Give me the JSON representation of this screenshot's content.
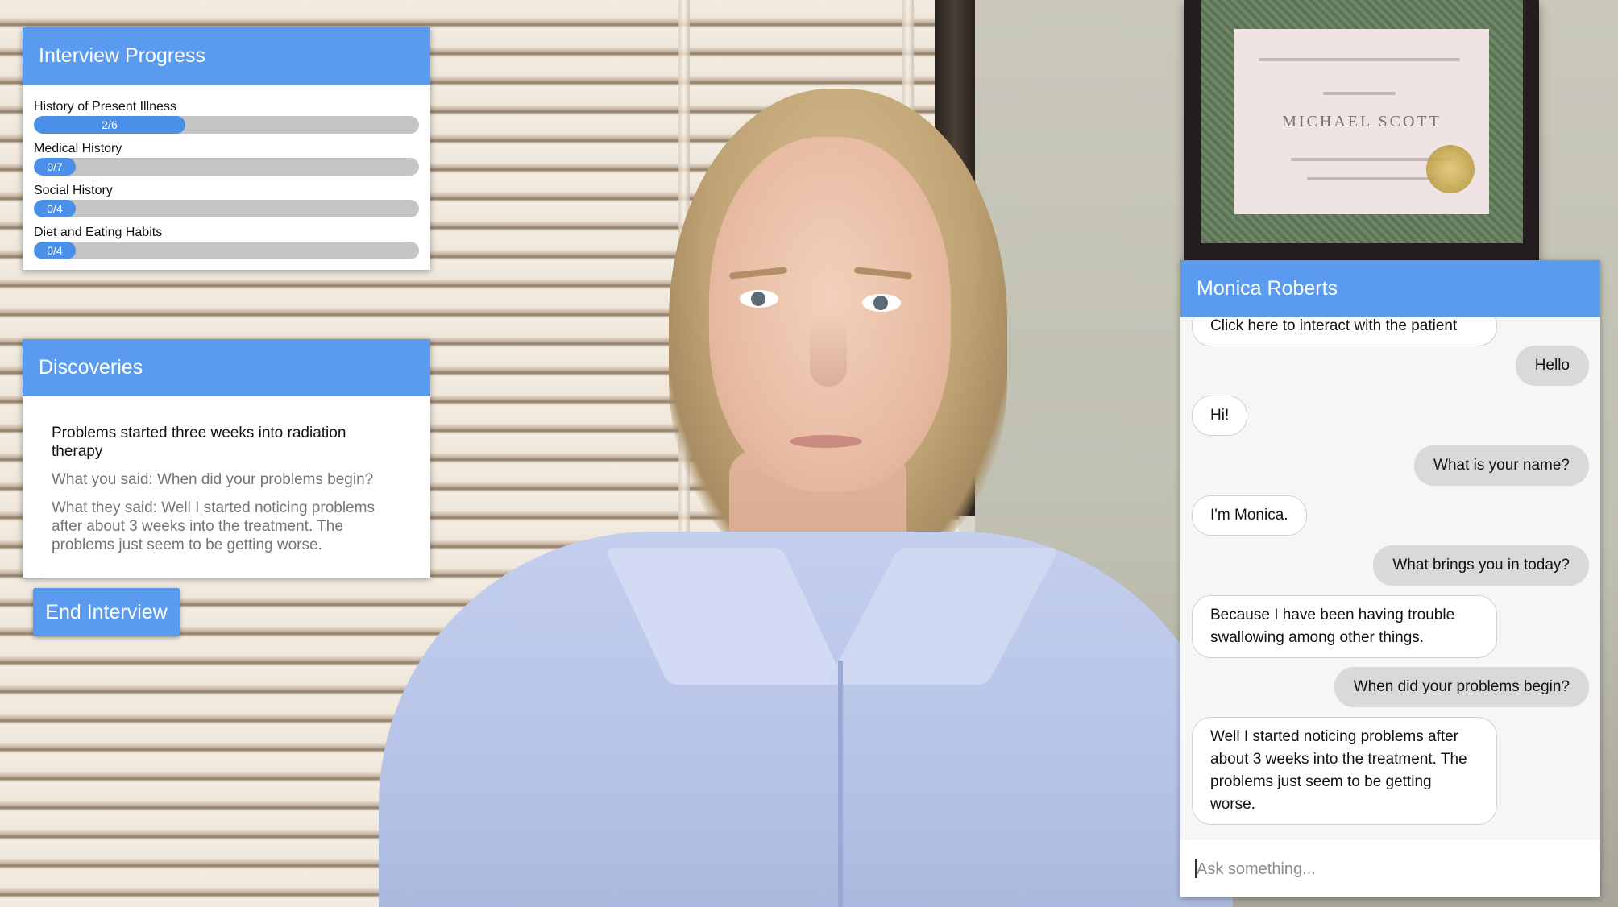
{
  "progress": {
    "title": "Interview Progress",
    "items": [
      {
        "label": "History of Present Illness",
        "display": "2/6",
        "fraction": 0.333
      },
      {
        "label": "Medical History",
        "display": "0/7",
        "fraction": 0
      },
      {
        "label": "Social History",
        "display": "0/4",
        "fraction": 0
      },
      {
        "label": "Diet and Eating Habits",
        "display": "0/4",
        "fraction": 0
      }
    ]
  },
  "discoveries": {
    "title": "Discoveries",
    "items": [
      {
        "heading": "Problems started three weeks into radiation therapy",
        "you_said": "What you said: When did your problems begin?",
        "they_said": "What they said: Well I started noticing problems after about 3 weeks into the treatment. The problems just seem to be getting worse."
      }
    ]
  },
  "actions": {
    "end_interview": "End Interview"
  },
  "chat": {
    "patient_name": "Monica Roberts",
    "messages": [
      {
        "from": "bot",
        "text": "Click here to interact with the patient"
      },
      {
        "from": "user",
        "text": "Hello"
      },
      {
        "from": "bot",
        "text": "Hi!"
      },
      {
        "from": "user",
        "text": "What is your name?"
      },
      {
        "from": "bot",
        "text": "I'm Monica."
      },
      {
        "from": "user",
        "text": "What brings you in today?"
      },
      {
        "from": "bot",
        "text": "Because I have been having trouble swallowing among other things."
      },
      {
        "from": "user",
        "text": "When did your problems begin?"
      },
      {
        "from": "bot",
        "text": "Well I started noticing problems after about 3 weeks into the treatment. The problems just seem to be getting worse."
      }
    ],
    "input_placeholder": "Ask something..."
  },
  "colors": {
    "accent": "#5a9bef",
    "progress_fill": "#4a8fe8",
    "progress_track": "#c5c5c5",
    "user_bubble": "#d9d9d9",
    "bot_bubble": "#ffffff"
  },
  "certificate": {
    "name": "MICHAEL SCOTT"
  }
}
